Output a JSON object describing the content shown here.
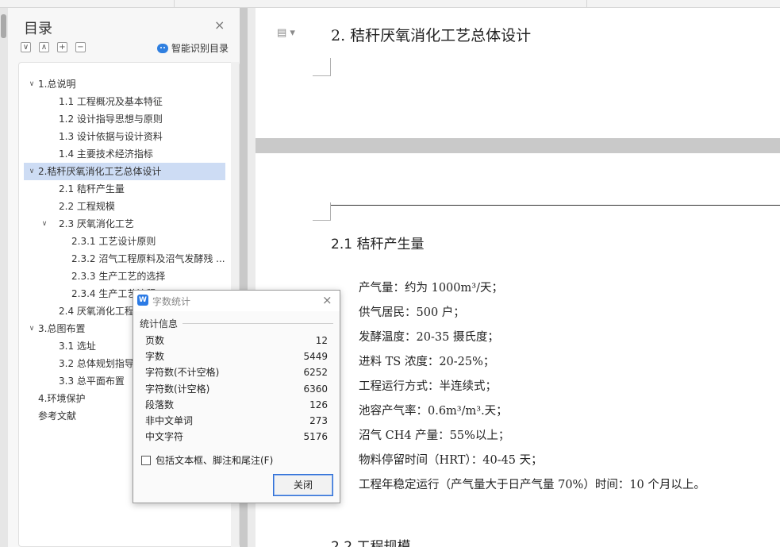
{
  "toc": {
    "title": "目录",
    "close_symbol": "×",
    "smart_label": "智能识别目录",
    "items": [
      {
        "label": "1.总说明",
        "level": 1,
        "chev": "∨"
      },
      {
        "label": "1.1 工程概况及基本特征",
        "level": 2
      },
      {
        "label": "1.2 设计指导思想与原则",
        "level": 2
      },
      {
        "label": "1.3 设计依据与设计资料",
        "level": 2
      },
      {
        "label": "1.4 主要技术经济指标",
        "level": 2
      },
      {
        "label": "2.秸秆厌氧消化工艺总体设计",
        "level": 1,
        "chev": "∨",
        "active": true
      },
      {
        "label": "2.1 秸秆产生量",
        "level": 2
      },
      {
        "label": "2.2 工程规模",
        "level": 2
      },
      {
        "label": "2.3 厌氧消化工艺",
        "level": 2,
        "chev": "∨"
      },
      {
        "label": "2.3.1 工艺设计原则",
        "level": 3
      },
      {
        "label": "2.3.2 沼气工程原料及沼气发酵残 ...",
        "level": 3
      },
      {
        "label": "2.3.3 生产工艺的选择",
        "level": 3
      },
      {
        "label": "2.3.4 生产工艺流程",
        "level": 3
      },
      {
        "label": "2.4 厌氧消化工程设",
        "level": 2
      },
      {
        "label": "3.总图布置",
        "level": 1,
        "chev": "∨"
      },
      {
        "label": "3.1  选址",
        "level": 2
      },
      {
        "label": "3.2  总体规划指导思",
        "level": 2
      },
      {
        "label": "3.3  总平面布置",
        "level": 2
      },
      {
        "label": "4.环境保护",
        "level": 1
      },
      {
        "label": "参考文献",
        "level": 1
      }
    ]
  },
  "document": {
    "heading": "2. 秸秆厌氧消化工艺总体设计",
    "section_title": "2.1 秸秆产生量",
    "lines": [
      "产气量：约为 1000m³/天；",
      "供气居民：500 户；",
      "发酵温度：20-35 摄氏度；",
      "进料 TS 浓度：20-25%；",
      "工程运行方式：半连续式；",
      "池容产气率：0.6m³/m³.天；",
      "沼气 CH4 产量：55%以上；",
      "物料停留时间（HRT）：40-45 天；",
      "工程年稳定运行（产气量大于日产气量 70%）时间：10 个月以上。"
    ],
    "next_section_title": "2.2 工程规模"
  },
  "dialog": {
    "title": "字数统计",
    "logo": "W",
    "close_symbol": "×",
    "group_label": "统计信息",
    "stats": [
      {
        "label": "页数",
        "value": "12"
      },
      {
        "label": "字数",
        "value": "5449"
      },
      {
        "label": "字符数(不计空格)",
        "value": "6252"
      },
      {
        "label": "字符数(计空格)",
        "value": "6360"
      },
      {
        "label": "段落数",
        "value": "126"
      },
      {
        "label": "非中文单词",
        "value": "273"
      },
      {
        "label": "中文字符",
        "value": "5176"
      }
    ],
    "checkbox_label": "包括文本框、脚注和尾注(F)",
    "checkbox_checked": false,
    "close_button_label": "关闭"
  }
}
